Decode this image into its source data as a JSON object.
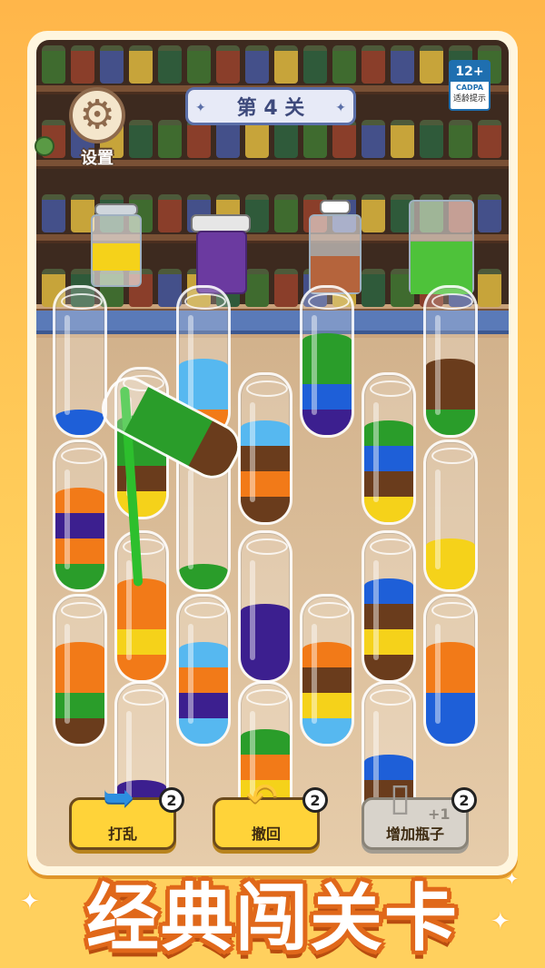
{
  "header": {
    "settings_label": "设置",
    "level_title": "第 4 关",
    "rating": {
      "age": "12+",
      "org": "CADPA",
      "tip": "适龄提示"
    }
  },
  "colors": {
    "blue": "#1e5fd8",
    "green": "#2a9d2a",
    "orange": "#f27a18",
    "brown": "#6a3c1c",
    "yellow": "#f5d21a",
    "purple": "#3c1f8f",
    "lightblue": "#56b8f0"
  },
  "tubes": [
    {
      "id": "t1",
      "layers": [
        "blue"
      ]
    },
    {
      "id": "t2",
      "layers": [
        "orange",
        "lightblue",
        "lightblue"
      ]
    },
    {
      "id": "t3",
      "layers": [
        "purple",
        "blue",
        "green",
        "green"
      ]
    },
    {
      "id": "t4",
      "layers": [
        "green",
        "brown",
        "brown"
      ]
    },
    {
      "id": "t5",
      "layers": [
        "yellow",
        "brown",
        "green",
        "green"
      ]
    },
    {
      "id": "t6",
      "layers": [
        "brown",
        "orange",
        "brown",
        "lightblue"
      ]
    },
    {
      "id": "t7",
      "layers": [
        "yellow",
        "brown",
        "blue",
        "green"
      ]
    },
    {
      "id": "t8",
      "layers": [
        "green",
        "orange",
        "purple",
        "orange"
      ]
    },
    {
      "id": "t9",
      "layers": [
        "green"
      ]
    },
    {
      "id": "t10",
      "layers": [
        "yellow",
        "yellow"
      ]
    },
    {
      "id": "t11",
      "layers": [
        "orange",
        "yellow",
        "orange",
        "orange"
      ]
    },
    {
      "id": "t12",
      "layers": [
        "purple",
        "purple",
        "purple"
      ]
    },
    {
      "id": "t13",
      "layers": [
        "brown",
        "yellow",
        "brown",
        "blue"
      ]
    },
    {
      "id": "t14",
      "layers": [
        "brown",
        "green",
        "orange",
        "orange"
      ]
    },
    {
      "id": "t15",
      "layers": [
        "lightblue",
        "purple",
        "orange",
        "lightblue"
      ]
    },
    {
      "id": "t16",
      "layers": [
        "lightblue",
        "yellow",
        "brown",
        "orange"
      ]
    },
    {
      "id": "t17",
      "layers": [
        "blue",
        "blue",
        "orange",
        "orange"
      ]
    },
    {
      "id": "t18",
      "layers": [
        "blue",
        "purple"
      ]
    },
    {
      "id": "t19",
      "layers": [
        "orange",
        "yellow",
        "orange",
        "green"
      ]
    },
    {
      "id": "t20",
      "layers": [
        "lightblue",
        "brown",
        "blue"
      ]
    }
  ],
  "buttons": {
    "shuffle": {
      "label": "打乱",
      "count": "2"
    },
    "undo": {
      "label": "撤回",
      "count": "2"
    },
    "add_bottle": {
      "label": "增加瓶子",
      "count": "2",
      "plus": "+1"
    }
  },
  "promo_title": "经典闯关卡"
}
